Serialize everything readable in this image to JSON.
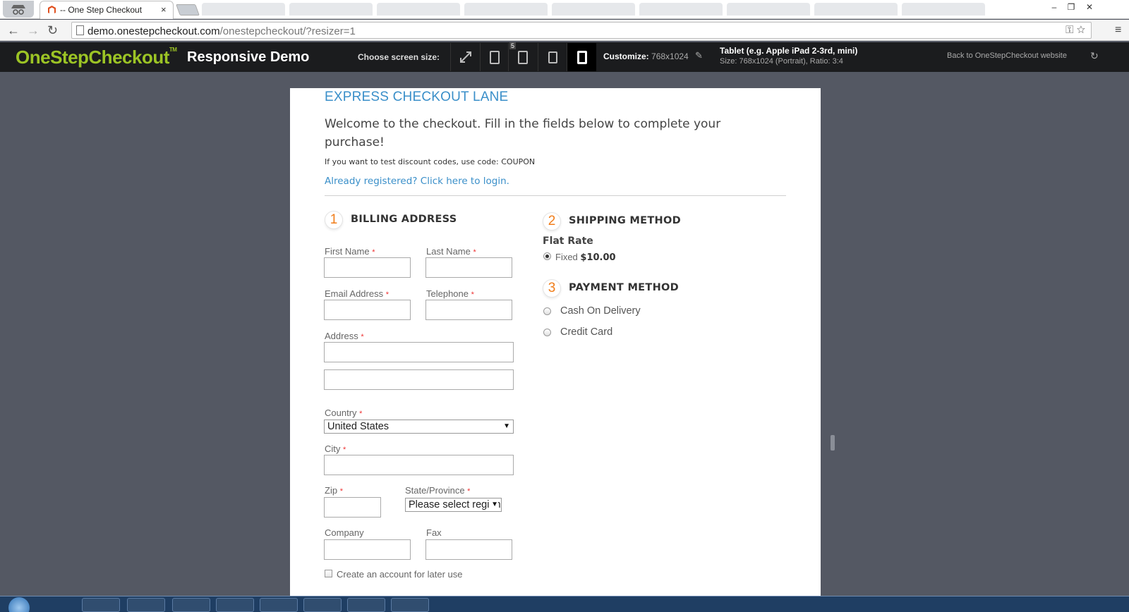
{
  "browser": {
    "tab_title": "-- One Step Checkout",
    "tab_close": "×",
    "url_host": "demo.onestepcheckout.com",
    "url_path": "/onestepcheckout/?resizer=1",
    "back": "←",
    "forward": "→",
    "reload": "↻",
    "window_min": "–",
    "window_max": "❐",
    "window_close": "✕",
    "menu": "≡",
    "omni_key": "⚿",
    "omni_star": "☆"
  },
  "toolbar": {
    "logo": "OneStepCheckout",
    "logo_tm": "TM",
    "demo_title": "Responsive Demo",
    "choose_label": "Choose screen size:",
    "device_badge": "5",
    "customize_label": "Customize:",
    "customize_value": "768x1024",
    "device_title": "Tablet (e.g. Apple iPad 2-3rd, mini)",
    "device_sub": "Size: 768x1024 (Portrait), Ratio: 3:4",
    "back_link": "Back to OneStepCheckout website"
  },
  "page": {
    "express_title": "EXPRESS CHECKOUT LANE",
    "welcome": "Welcome to the checkout. Fill in the fields below to complete your purchase!",
    "discount_note": "If you want to test discount codes, use code: COUPON",
    "login_link": "Already registered? Click here to login.",
    "billing": {
      "step": "1",
      "title": "BILLING ADDRESS",
      "required_mark": "*",
      "first_name": "First Name",
      "last_name": "Last Name",
      "email": "Email Address",
      "telephone": "Telephone",
      "address": "Address",
      "country": "Country",
      "country_value": "United States",
      "city": "City",
      "zip": "Zip",
      "state": "State/Province",
      "state_value": "Please select region",
      "company": "Company",
      "fax": "Fax",
      "create_account": "Create an account for later use"
    },
    "shipping": {
      "step": "2",
      "title": "SHIPPING METHOD",
      "method_name": "Flat Rate",
      "option_label": "Fixed",
      "option_price": "$10.00"
    },
    "payment": {
      "step": "3",
      "title": "PAYMENT METHOD",
      "options": [
        "Cash On Delivery",
        "Credit Card"
      ]
    }
  },
  "colors": {
    "brand_green": "#9cc425",
    "link_blue": "#3a8fc9",
    "step_orange": "#f07d1a",
    "toolbar_bg": "#1b1c1e",
    "backdrop": "#545863"
  }
}
